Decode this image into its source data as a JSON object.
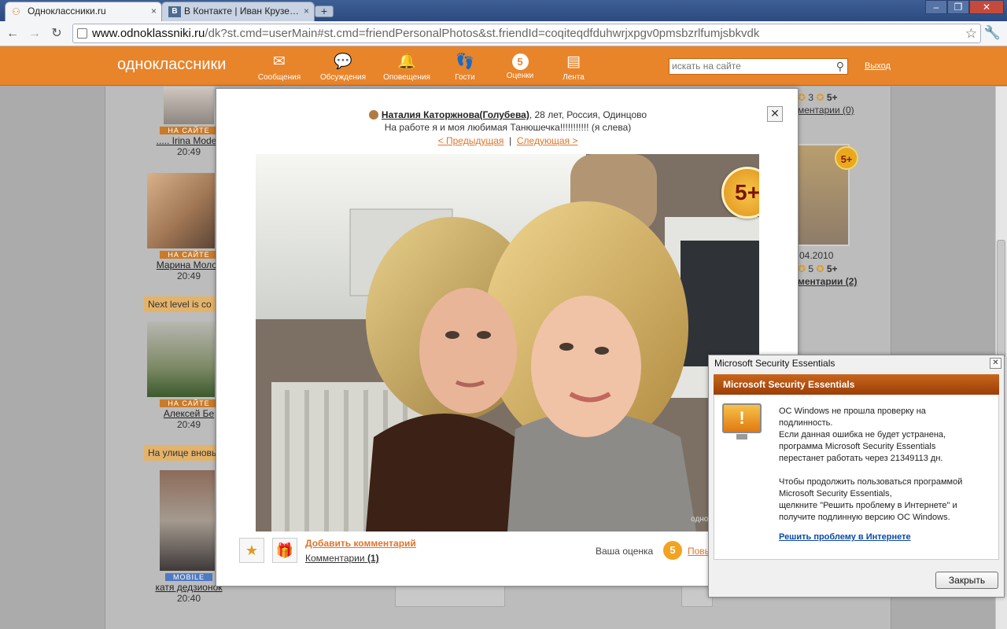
{
  "browser": {
    "tabs": [
      {
        "title": "Одноклассники.ru",
        "favicon": "odnoklassniki-icon"
      },
      {
        "title": "В Контакте | Иван Крузе…",
        "favicon": "vkontakte-icon"
      }
    ],
    "address": {
      "host": "www.odnoklassniki.ru",
      "path": "/dk?st.cmd=userMain#st.cmd=friendPersonalPhotos&st.friendId=coqiteqdfduhwrjxpgv0pmsbzrlfumjsbkvdk"
    }
  },
  "site": {
    "logo": "одноклассники",
    "nav": [
      {
        "label": "Сообщения",
        "icon": "envelope-icon"
      },
      {
        "label": "Обсуждения",
        "icon": "chat-bubbles-icon"
      },
      {
        "label": "Оповещения",
        "icon": "bell-icon"
      },
      {
        "label": "Гости",
        "icon": "footprints-icon"
      },
      {
        "label": "Оценки",
        "icon": "rating-badge-icon",
        "badge": "5"
      },
      {
        "label": "Лента",
        "icon": "feed-icon"
      }
    ],
    "search_placeholder": "искать на сайте",
    "logout": "Выход"
  },
  "friends": [
    {
      "tag": "НА САЙТЕ",
      "name": "..... Irina Modes",
      "time": "20:49"
    },
    {
      "tag": "НА САЙТЕ",
      "name": "Марина Молок",
      "time": "20:49"
    },
    {
      "status": "Next level is co",
      "tag": "НА САЙТЕ",
      "name": "Алексей Бе",
      "time": "20:49"
    },
    {
      "status": "На улице вновь",
      "tag": "MOBILE",
      "name": "катя дедзионок",
      "time": "20:40"
    }
  ],
  "right_column": {
    "top_stats": {
      "count": "3",
      "grade": "5+",
      "comments": "ментарии (0)"
    },
    "date": "04.2010",
    "stats": {
      "count": "5",
      "grade": "5+",
      "comments": "ментарии (2)"
    },
    "badge": "5+"
  },
  "modal": {
    "owner_name": "Наталия Каторжнова(Голубева)",
    "owner_info": ", 28 лет, Россия, Одинцово",
    "caption": "На работе я и моя любимая Танюшечка!!!!!!!!!!! (я слева)",
    "prev": "< Предыдущая",
    "separator": "|",
    "next": "Следующая >",
    "close": "✕",
    "photo_badge": "5+",
    "watermark": "одноклассники.ru",
    "add_comment": "Добавить комментарий",
    "comments_label": "Комментарии",
    "comments_count": "(1)",
    "rating_label": "Ваша оценка",
    "rating_value": "5",
    "rating_more": "Повысить"
  },
  "mse": {
    "window_title": "Microsoft Security Essentials",
    "banner": "Microsoft Security Essentials",
    "p1_line1": "ОС Windows не прошла проверку на",
    "p1_line2": "подлинность.",
    "p1_line3": "Если данная ошибка не будет устранена,",
    "p1_line4": "программа Microsoft Security Essentials",
    "p1_line5": "перестанет работать через 21349113 дн.",
    "p2_line1": "Чтобы продолжить пользоваться программой",
    "p2_line2": "Microsoft Security Essentials,",
    "p2_line3": "щелкните \"Решить проблему в Интернете\" и",
    "p2_line4": "получите подлинную версию ОС Windows.",
    "link": "Решить проблему в Интернете",
    "close_button": "Закрыть"
  },
  "colors": {
    "brand_orange": "#e8842a",
    "link_orange": "#e0742a",
    "mse_banner": "#b0500f"
  }
}
